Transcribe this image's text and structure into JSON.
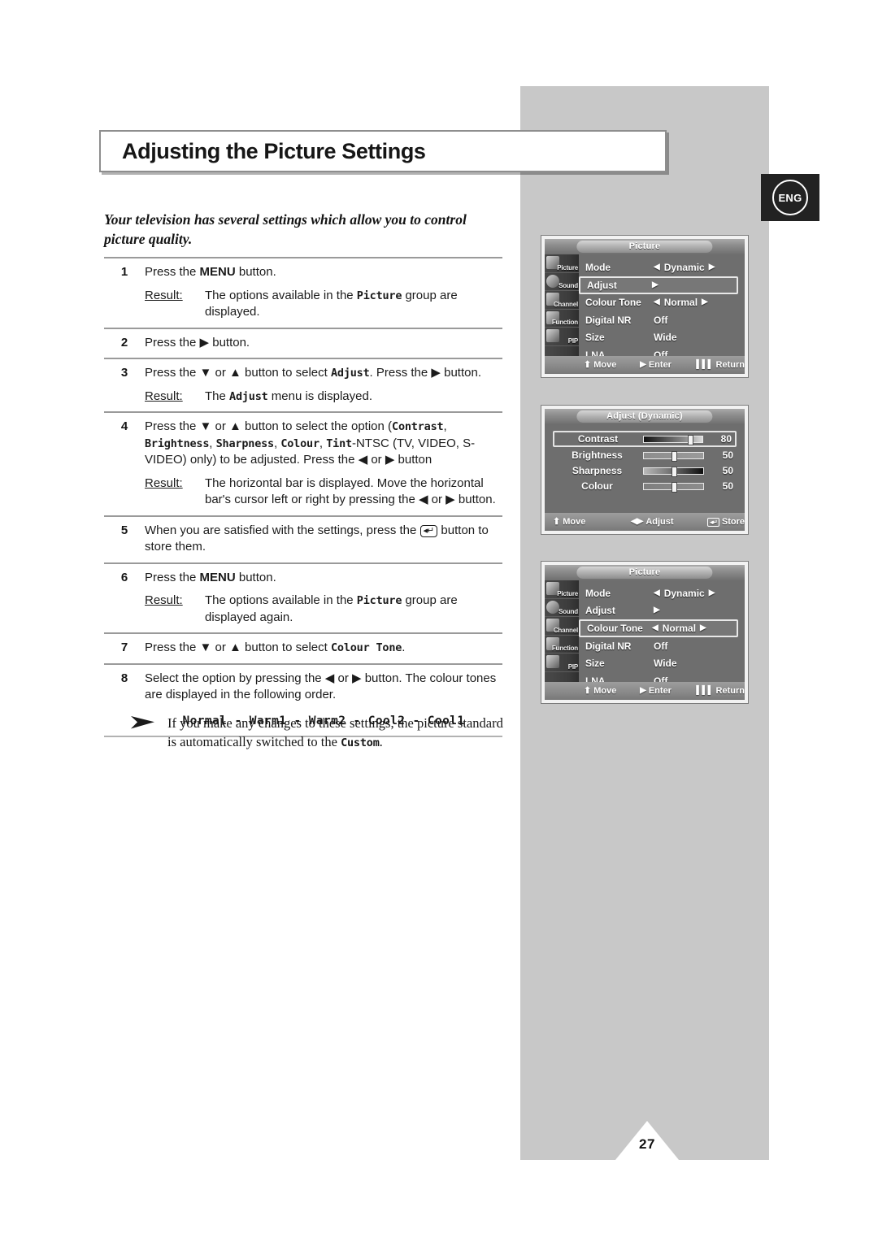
{
  "page": {
    "title": "Adjusting the Picture Settings",
    "number": "27",
    "language_badge": "ENG"
  },
  "intro": "Your television has several settings which allow you to control picture quality.",
  "steps": [
    {
      "num": "1",
      "text_before": "Press the ",
      "bold": "MENU",
      "text_after": " button.",
      "result_label": "Result:",
      "result_before": "The options available in the ",
      "result_mono": "Picture",
      "result_after": " group are displayed."
    },
    {
      "num": "2",
      "text": "Press the ▶ button."
    },
    {
      "num": "3",
      "text_before": "Press the ▼ or ▲ button to select ",
      "mono": "Adjust",
      "text_after": ". Press the ▶ button.",
      "result_label": "Result:",
      "result_before": "The ",
      "result_mono": "Adjust",
      "result_after": " menu is displayed."
    },
    {
      "num": "4",
      "line1_before": "Press the ▼ or ▲ button to select the option (",
      "mono1": "Contrast",
      "line1_after": ",",
      "mono2": "Brightness",
      "sep2": ", ",
      "mono3": "Sharpness",
      "sep3": ", ",
      "mono4": "Colour",
      "sep4": ", ",
      "mono5": "Tint",
      "line2_after": "-NTSC (TV, VIDEO, S-VIDEO) only) to be adjusted. Press the ◀ or ▶ button",
      "result_label": "Result:",
      "result_text": "The horizontal bar is displayed. Move the horizontal bar's cursor left or right by pressing the ◀ or ▶ button."
    },
    {
      "num": "5",
      "text_before": "When you are satisfied with the settings, press the ",
      "key_icon": "enter-key-icon",
      "text_after": " button to store them."
    },
    {
      "num": "6",
      "text_before": "Press the ",
      "bold": "MENU",
      "text_after": " button.",
      "result_label": "Result:",
      "result_before": "The options available in the ",
      "result_mono": "Picture",
      "result_after": " group are displayed again."
    },
    {
      "num": "7",
      "text_before": "Press the ▼ or ▲ button to select  ",
      "mono": "Colour Tone",
      "text_after": "."
    },
    {
      "num": "8",
      "text": "Select the option by pressing the ◀ or ▶ button. The colour tones are displayed in the following order.",
      "order": "Normal - Warm1 - Warm2 - Cool2 - Cool1"
    }
  ],
  "note": {
    "icon": "arrow-bullet-icon",
    "text_before": "If you make any changes to these settings, the picture standard is automatically switched to the ",
    "mono": "Custom",
    "text_after": "."
  },
  "osd_sidebar": [
    {
      "label": "Picture",
      "icon": "picture-icon"
    },
    {
      "label": "Sound",
      "icon": "sound-icon"
    },
    {
      "label": "Channel",
      "icon": "channel-icon"
    },
    {
      "label": "Function",
      "icon": "function-icon"
    },
    {
      "label": "PIP",
      "icon": "pip-icon"
    }
  ],
  "osd_menus": [
    {
      "id": "picture-menu-1",
      "title": "Picture",
      "rows": [
        {
          "label": "Mode",
          "value": "Dynamic",
          "arrows": true,
          "highlight": false
        },
        {
          "label": "Adjust",
          "value": "",
          "arrows": false,
          "submenu": true,
          "highlight": true
        },
        {
          "label": "Colour Tone",
          "value": "Normal",
          "arrows": true,
          "highlight": false
        },
        {
          "label": "Digital NR",
          "value": "Off",
          "arrows": false,
          "highlight": false
        },
        {
          "label": "Size",
          "value": "Wide",
          "arrows": false,
          "highlight": false
        },
        {
          "label": "LNA",
          "value": "Off",
          "arrows": false,
          "highlight": false
        }
      ],
      "footer": [
        {
          "icon": "up-down-icon",
          "label": "Move"
        },
        {
          "icon": "right-arrow-icon",
          "label": "Enter"
        },
        {
          "icon": "menu-bars-icon",
          "label": "Return"
        }
      ]
    },
    {
      "id": "adjust-menu",
      "title": "Adjust (Dynamic)",
      "sliders": [
        {
          "label": "Contrast",
          "value": "80",
          "percent": 80,
          "highlight": true
        },
        {
          "label": "Brightness",
          "value": "50",
          "percent": 50,
          "highlight": false
        },
        {
          "label": "Sharpness",
          "value": "50",
          "percent": 50,
          "highlight": false
        },
        {
          "label": "Colour",
          "value": "50",
          "percent": 50,
          "highlight": false
        }
      ],
      "footer": [
        {
          "icon": "up-down-icon",
          "label": "Move"
        },
        {
          "icon": "left-right-icon",
          "label": "Adjust"
        },
        {
          "icon": "store-key-icon",
          "label": "Store"
        }
      ]
    },
    {
      "id": "picture-menu-2",
      "title": "Picture",
      "rows": [
        {
          "label": "Mode",
          "value": "Dynamic",
          "arrows": true,
          "highlight": false
        },
        {
          "label": "Adjust",
          "value": "",
          "arrows": false,
          "submenu": true,
          "highlight": false
        },
        {
          "label": "Colour Tone",
          "value": "Normal",
          "arrows": true,
          "highlight": true
        },
        {
          "label": "Digital NR",
          "value": "Off",
          "arrows": false,
          "highlight": false
        },
        {
          "label": "Size",
          "value": "Wide",
          "arrows": false,
          "highlight": false
        },
        {
          "label": "LNA",
          "value": "Off",
          "arrows": false,
          "highlight": false
        }
      ],
      "footer": [
        {
          "icon": "up-down-icon",
          "label": "Move"
        },
        {
          "icon": "right-arrow-icon",
          "label": "Enter"
        },
        {
          "icon": "menu-bars-icon",
          "label": "Return"
        }
      ]
    }
  ]
}
